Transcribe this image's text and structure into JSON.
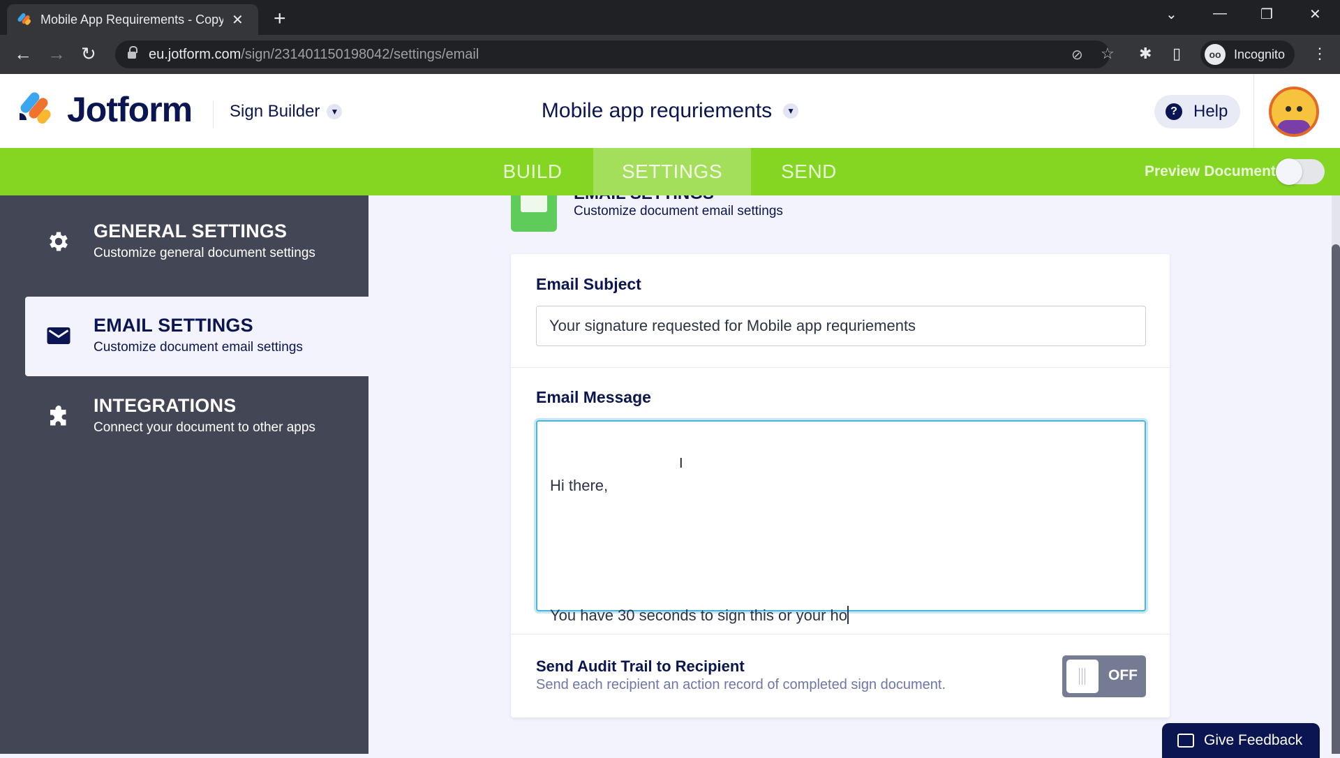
{
  "browser": {
    "tab_title": "Mobile App Requirements - Copy",
    "new_tab_label": "+",
    "url_host": "eu.jotform.com",
    "url_path": "/sign/231401150198042/settings/email",
    "profile_label": "Incognito",
    "window_controls": {
      "minimize": "—",
      "restore": "❐",
      "close": "✕",
      "tab_search": "⌄"
    }
  },
  "header": {
    "brand": "Jotform",
    "builder_label": "Sign Builder",
    "document_title": "Mobile app requriements",
    "help_label": "Help"
  },
  "nav": {
    "tabs": [
      {
        "label": "BUILD",
        "active": false
      },
      {
        "label": "SETTINGS",
        "active": true
      },
      {
        "label": "SEND",
        "active": false
      }
    ],
    "preview_label": "Preview Document",
    "preview_on": false
  },
  "sidebar": {
    "items": [
      {
        "title": "GENERAL SETTINGS",
        "subtitle": "Customize general document settings",
        "icon": "gear-icon",
        "active": false
      },
      {
        "title": "EMAIL SETTINGS",
        "subtitle": "Customize document email settings",
        "icon": "envelope-icon",
        "active": true
      },
      {
        "title": "INTEGRATIONS",
        "subtitle": "Connect your document to other apps",
        "icon": "puzzle-icon",
        "active": false
      }
    ]
  },
  "section": {
    "title": "EMAIL SETTINGS",
    "subtitle": "Customize document email settings"
  },
  "form": {
    "subject_label": "Email Subject",
    "subject_value": "Your signature requested for Mobile app requriements",
    "message_label": "Email Message",
    "message_line1": "Hi there,",
    "message_line2": "You have 30 seconds to sign this or your ho",
    "audit_title": "Send Audit Trail to Recipient",
    "audit_subtitle": "Send each recipient an action record of completed sign document.",
    "audit_state": "OFF"
  },
  "feedback_label": "Give Feedback",
  "colors": {
    "accent_green": "#85d623",
    "brand_navy": "#0a1551",
    "sidebar_bg": "#434655"
  }
}
